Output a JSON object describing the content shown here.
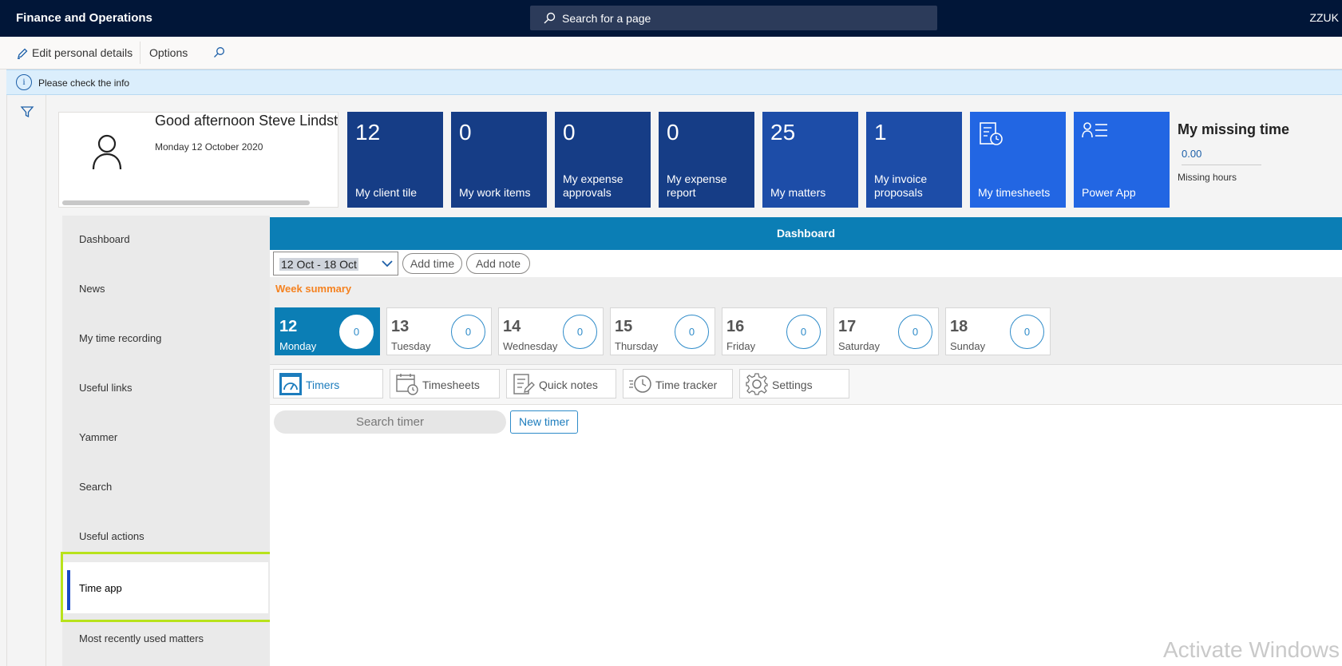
{
  "topbar": {
    "app_title": "Finance and Operations",
    "search_placeholder": "Search for a page",
    "user": "ZZUK"
  },
  "actionbar": {
    "edit_personal_details": "Edit personal details",
    "options": "Options"
  },
  "infobar": {
    "message": "Please check the info"
  },
  "profile": {
    "greeting": "Good afternoon Steve Lindstrom",
    "date": "Monday 12 October 2020"
  },
  "tiles": [
    {
      "value": "12",
      "label": "My client tile"
    },
    {
      "value": "0",
      "label": "My work items"
    },
    {
      "value": "0",
      "label": "My expense approvals"
    },
    {
      "value": "0",
      "label": "My expense report"
    },
    {
      "value": "25",
      "label": "My matters"
    },
    {
      "value": "1",
      "label": "My invoice proposals"
    },
    {
      "label": "My timesheets",
      "icon": "timesheet-icon"
    },
    {
      "label": "Power App",
      "icon": "person-list-icon"
    }
  ],
  "missing_time": {
    "title": "My missing time",
    "value": "0.00",
    "label": "Missing hours"
  },
  "nav": [
    "Dashboard",
    "News",
    "My time recording",
    "Useful links",
    "Yammer",
    "Search",
    "Useful actions",
    "Time app",
    "Most recently used matters"
  ],
  "dashboard": {
    "header": "Dashboard",
    "date_range": "12 Oct - 18 Oct",
    "add_time": "Add time",
    "add_note": "Add note",
    "week_summary": "Week summary",
    "days": [
      {
        "num": "12",
        "name": "Monday",
        "count": "0"
      },
      {
        "num": "13",
        "name": "Tuesday",
        "count": "0"
      },
      {
        "num": "14",
        "name": "Wednesday",
        "count": "0"
      },
      {
        "num": "15",
        "name": "Thursday",
        "count": "0"
      },
      {
        "num": "16",
        "name": "Friday",
        "count": "0"
      },
      {
        "num": "17",
        "name": "Saturday",
        "count": "0"
      },
      {
        "num": "18",
        "name": "Sunday",
        "count": "0"
      }
    ],
    "tabs": [
      "Timers",
      "Timesheets",
      "Quick notes",
      "Time tracker",
      "Settings"
    ],
    "search_timer": "Search timer",
    "new_timer": "New timer"
  },
  "watermark": "Activate Windows",
  "colors": {
    "topbar": "#011638",
    "tile_dark": "#163d86",
    "tile_bright": "#2266e3",
    "dashboard_header": "#0b7eb5",
    "week_summary": "#f58220",
    "highlight": "#b8e21b"
  }
}
